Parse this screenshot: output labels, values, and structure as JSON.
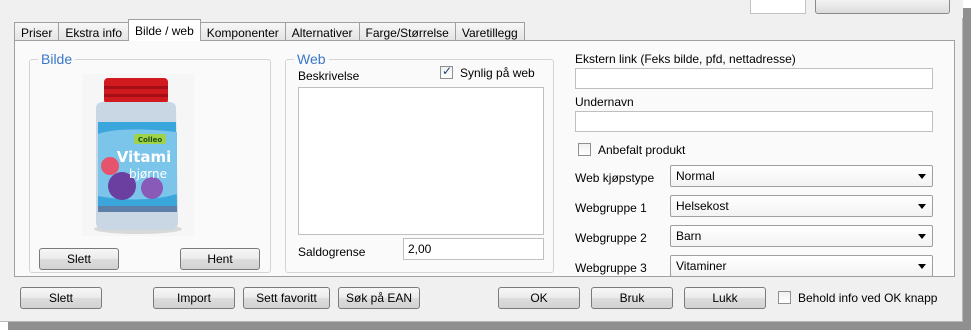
{
  "tabs": [
    {
      "label": "Priser"
    },
    {
      "label": "Ekstra info"
    },
    {
      "label": "Bilde / web",
      "active": true
    },
    {
      "label": "Komponenter"
    },
    {
      "label": "Alternativer"
    },
    {
      "label": "Farge/Størrelse"
    },
    {
      "label": "Varetillegg"
    }
  ],
  "bilde": {
    "title": "Bilde",
    "delete_label": "Slett",
    "fetch_label": "Hent",
    "product_label_top": "Colleo",
    "product_label_main": "Vitami",
    "product_label_sub": "bjørne"
  },
  "web": {
    "title": "Web",
    "description_label": "Beskrivelse",
    "visible_label": "Synlig på web",
    "visible_checked": true,
    "description_value": "",
    "saldo_label": "Saldogrense",
    "saldo_value": "2,00"
  },
  "right": {
    "external_link_label": "Ekstern link (Feks bilde, pfd, nettadresse)",
    "external_link_value": "",
    "subname_label": "Undernavn",
    "subname_value": "",
    "recommended_label": "Anbefalt produkt",
    "recommended_checked": false,
    "fields": [
      {
        "label": "Web kjøpstype",
        "value": "Normal"
      },
      {
        "label": "Webgruppe 1",
        "value": "Helsekost"
      },
      {
        "label": "Webgruppe 2",
        "value": "Barn"
      },
      {
        "label": "Webgruppe 3",
        "value": "Vitaminer"
      }
    ]
  },
  "footer": {
    "delete": "Slett",
    "import": "Import",
    "favorite": "Sett favoritt",
    "ean": "Søk på EAN",
    "ok": "OK",
    "apply": "Bruk",
    "close": "Lukk",
    "keep_label": "Behold info ved OK knapp",
    "keep_checked": false
  },
  "colors": {
    "accent_title": "#3a78c8",
    "window_bg": "#f0f0f0",
    "panel_bg": "#fafafa"
  }
}
